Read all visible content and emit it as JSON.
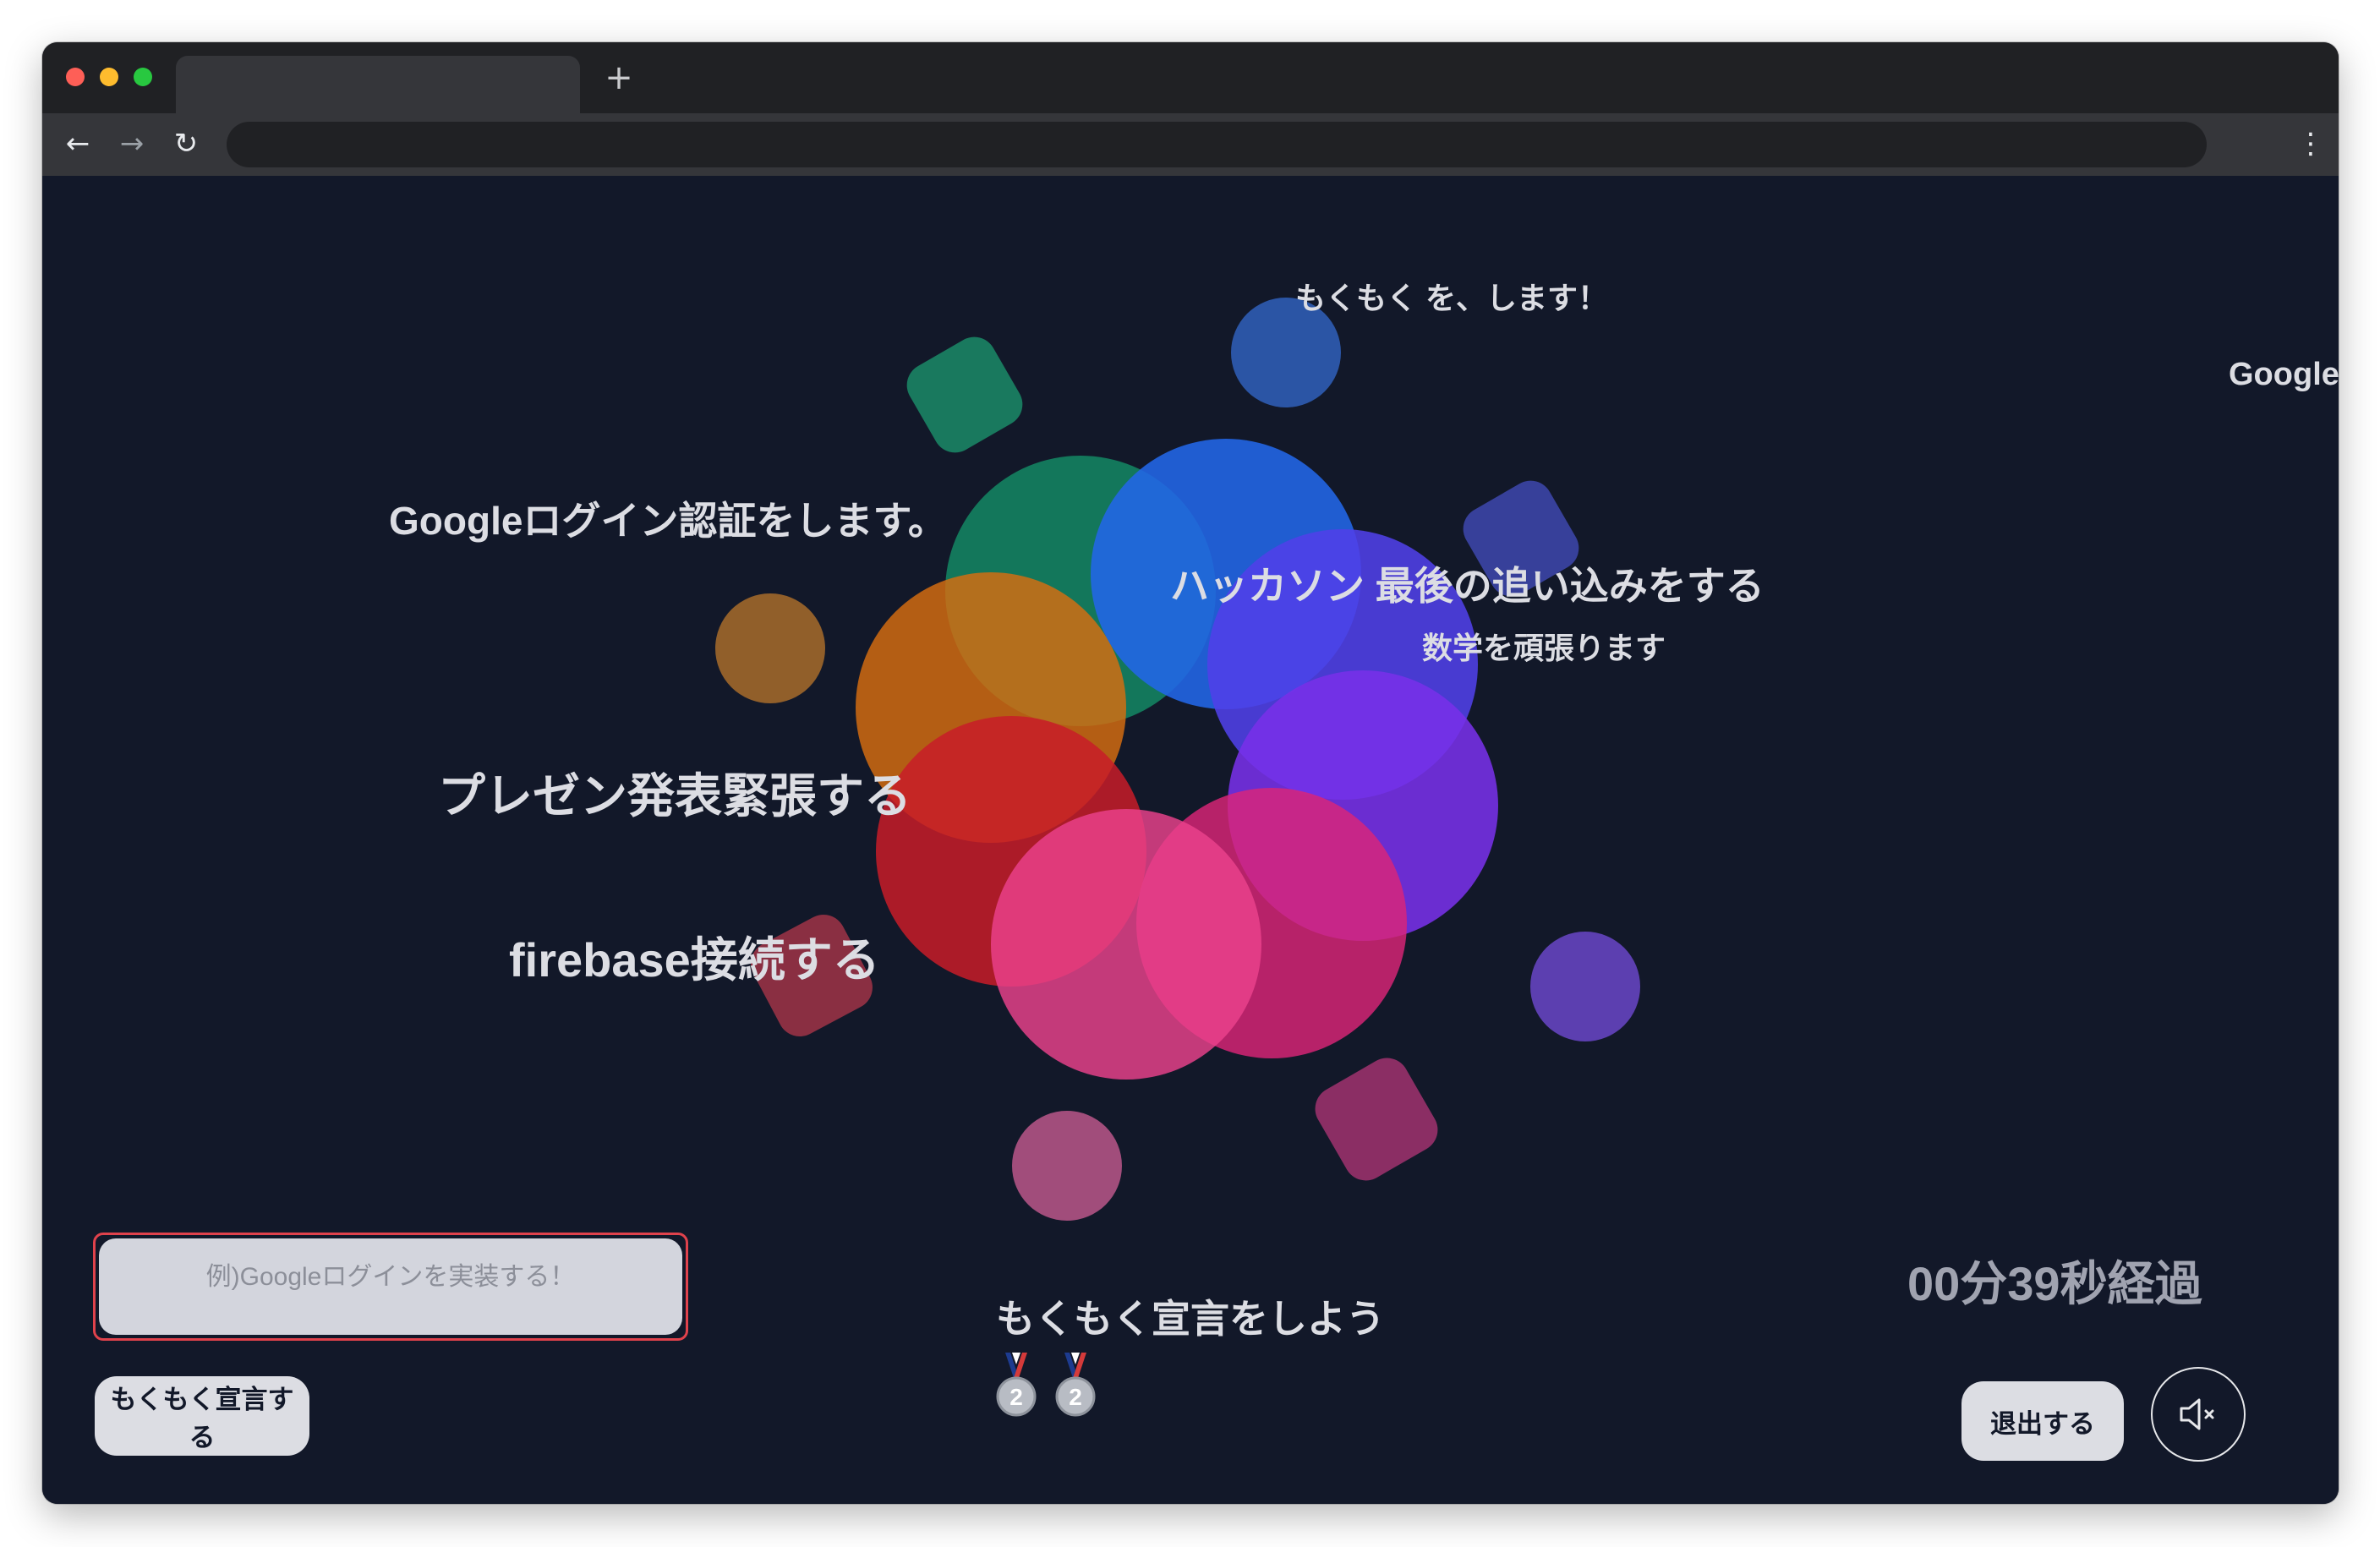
{
  "browser": {
    "tab_title": "",
    "new_tab_icon": "+",
    "back_icon": "←",
    "forward_icon": "→",
    "reload_icon": "↻",
    "menu_icon": "⋮",
    "address": ""
  },
  "floating_declarations": [
    "もくもく を、します！",
    "Google",
    "Googleログイン認証をします。",
    "ハッカソン 最後の追い込みをする",
    "数学を頑張ります",
    "プレゼン発表緊張する",
    "firebase接続する"
  ],
  "composer": {
    "placeholder": "例)Googleログインを実装する！",
    "value": "",
    "submit_label": "もくもく宣言する"
  },
  "prompt_text": "もくもく宣言をしよう",
  "medals": [
    {
      "icon": "silver-medal",
      "rank": "2"
    },
    {
      "icon": "silver-medal",
      "rank": "2"
    }
  ],
  "elapsed_label": "00分39秒経過",
  "exit_label": "退出する",
  "mute_icon": "speaker-muted",
  "colors": {
    "background": "#121829",
    "text_light": "#dcdde3",
    "input_border": "#e0424c",
    "button_bg": "#dcdde3"
  }
}
